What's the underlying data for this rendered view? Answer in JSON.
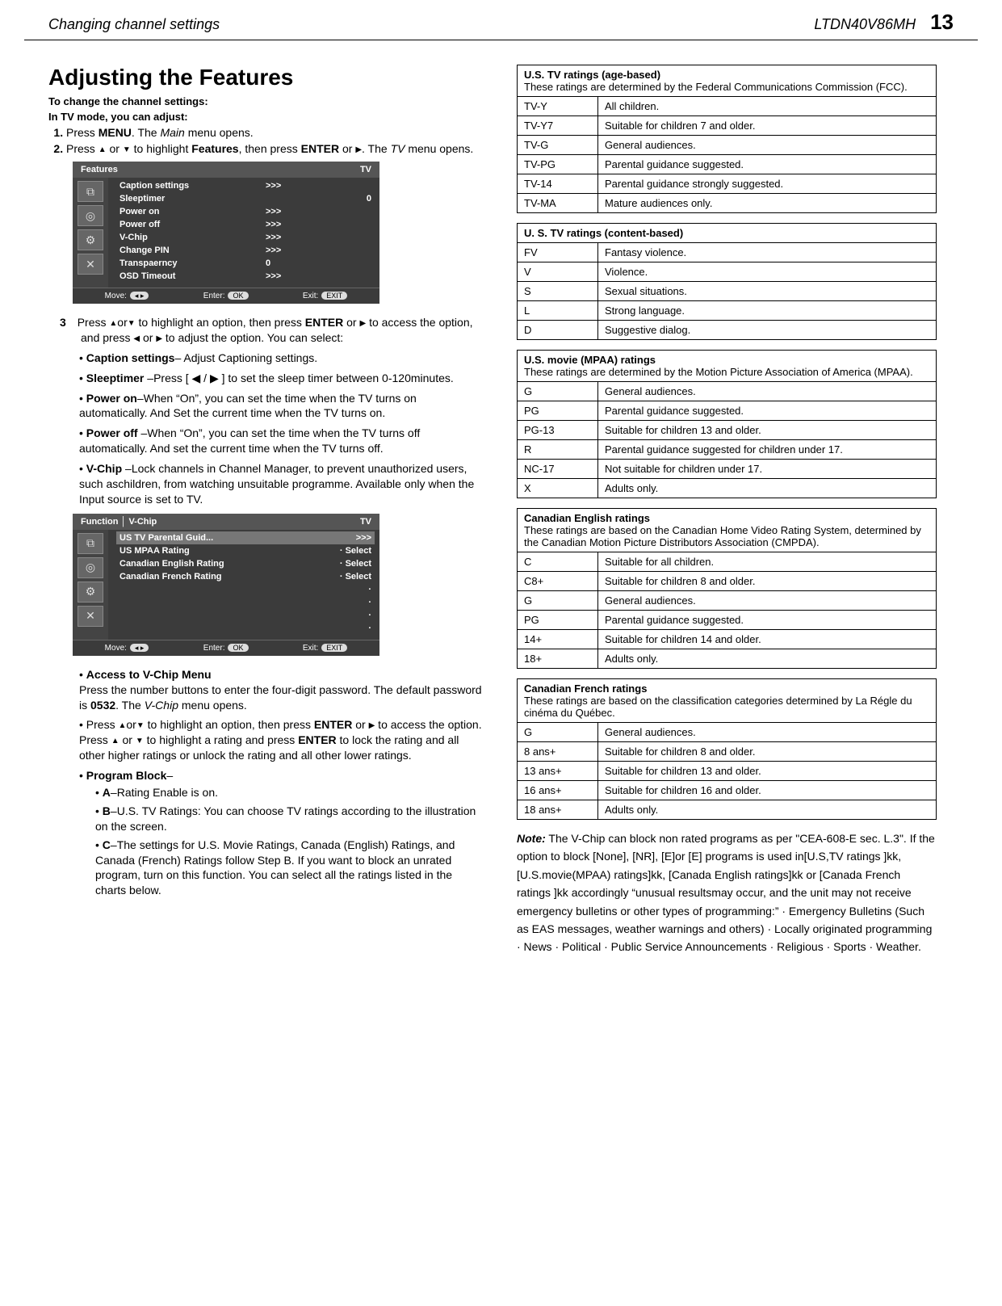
{
  "header": {
    "section": "Changing channel settings",
    "model": "LTDN40V86MH",
    "page": "13"
  },
  "left": {
    "title": "Adjusting the Features",
    "pre1": "To change the channel settings:",
    "pre2": "In TV mode, you can adjust:",
    "step1_a": "Press ",
    "step1_menu": "MENU",
    "step1_b": ". The ",
    "step1_ital": "Main",
    "step1_c": " menu opens.",
    "step2_a": "Press ",
    "step2_b": " or ",
    "step2_c": " to highlight ",
    "step2_feat": "Features",
    "step2_d": ", then press ",
    "step2_enter": "ENTER",
    "step2_e": " or ",
    "step2_f": ". The ",
    "step2_ital": "TV",
    "step2_g": " menu opens.",
    "osd1": {
      "title": "Features",
      "mode": "TV",
      "rows": [
        {
          "label": "Caption settings",
          "arrow": ">>>",
          "val": ""
        },
        {
          "label": "Sleeptimer",
          "arrow": "",
          "val": "0"
        },
        {
          "label": "Power on",
          "arrow": ">>>",
          "val": ""
        },
        {
          "label": "Power off",
          "arrow": ">>>",
          "val": ""
        },
        {
          "label": "V-Chip",
          "arrow": ">>>",
          "val": ""
        },
        {
          "label": "Change PIN",
          "arrow": ">>>",
          "val": ""
        },
        {
          "label": "Transpaerncy",
          "arrow": "0",
          "val": ""
        },
        {
          "label": "OSD Timeout",
          "arrow": ">>>",
          "val": ""
        }
      ],
      "ft_move": "Move:",
      "ft_enter": "Enter:",
      "ft_exit": "Exit:",
      "b_ok": "OK",
      "b_exit": "EXIT"
    },
    "step3": {
      "a": "Press ",
      "b": "or",
      "c": " to highlight an option, then press ",
      "enter": "ENTER",
      "d": " or ",
      "e": " to access the option, and press ",
      "f": " or ",
      "g": " to adjust  the option. You can select:"
    },
    "bullets": [
      {
        "b": "Caption settings",
        "t": "– Adjust Captioning settings."
      },
      {
        "b": "Sleeptimer",
        "t": " –Press [ ◀ / ▶ ] to set the sleep timer between 0-120minutes."
      },
      {
        "b": "Power on",
        "t": "–When “On”, you can set the time when the TV turns on automatically. And Set the current time when the TV turns on."
      },
      {
        "b": "Power off",
        "t": " –When “On”, you can set the time when the TV turns off automatically. And set the current time when the TV turns off."
      },
      {
        "b": "V-Chip",
        "t": " –Lock channels in Channel Manager, to prevent unauthorized  users, such aschildren, from watching unsuitable programme. Available only when the Input source is set to TV."
      }
    ],
    "osd2": {
      "func": "Function",
      "title": "V-Chip",
      "mode": "TV",
      "rows": [
        {
          "label": "US TV Parental Guid...",
          "val": ">>>",
          "sel": true
        },
        {
          "label": "US MPAA Rating",
          "val": "·  Select"
        },
        {
          "label": "Canadian English Rating",
          "val": "·  Select"
        },
        {
          "label": "Canadian French Rating",
          "val": "·  Select"
        },
        {
          "label": "",
          "val": "·"
        },
        {
          "label": "",
          "val": "·"
        },
        {
          "label": "",
          "val": "·"
        },
        {
          "label": "",
          "val": "·"
        }
      ],
      "ft_move": "Move:",
      "ft_enter": "Enter:",
      "ft_exit": "Exit:",
      "b_ok": "OK",
      "b_exit": "EXIT"
    },
    "after": {
      "acc_h": "Access to V-Chip Menu",
      "acc_t": "Press the number buttons to enter the four-digit password. The default password is ",
      "acc_pin": "0532",
      "acc_t2": ". The ",
      "acc_ital": "V-Chip",
      "acc_t3": " menu opens.",
      "press_a": "Press ",
      "press_b": "or",
      "press_c": " to highlight an option, then press ",
      "press_enter": "ENTER",
      "press_d": " or ",
      "press_e": " to access the option. Press ",
      "press_f": " or ",
      "press_g": " to highlight a rating and press  ",
      "press_enter2": "ENTER",
      "press_h": "   to lock the rating and all other higher ratings or unlock the rating and all other lower ratings.",
      "pb_h": "Program Block",
      "pb_a": "A",
      "pb_at": "–Rating Enable is on.",
      "pb_b": "B",
      "pb_bt": "–U.S. TV Ratings: You can choose TV ratings according to the illustration on the screen.",
      "pb_c": "C",
      "pb_ct": "–The settings for U.S. Movie Ratings, Canada (English) Ratings, and Canada (French) Ratings follow Step B. If you want to block an unrated program, turn on this function. You can select all the ratings listed in the charts below."
    }
  },
  "right": {
    "t1_h": "U.S. TV ratings (age-based)",
    "t1_d": "These ratings are determined by the Federal Communications Commission (FCC).",
    "t1": [
      [
        "TV-Y",
        "All children."
      ],
      [
        "TV-Y7",
        "Suitable for children 7 and older."
      ],
      [
        "TV-G",
        "General audiences."
      ],
      [
        "TV-PG",
        "Parental guidance suggested."
      ],
      [
        "TV-14",
        "Parental guidance strongly suggested."
      ],
      [
        "TV-MA",
        "Mature audiences only."
      ]
    ],
    "t2_h": "U. S. TV ratings (content-based)",
    "t2": [
      [
        "FV",
        "Fantasy violence."
      ],
      [
        "V",
        "Violence."
      ],
      [
        "S",
        "Sexual situations."
      ],
      [
        "L",
        "Strong language."
      ],
      [
        "D",
        "Suggestive dialog."
      ]
    ],
    "t3_h": "U.S. movie (MPAA) ratings",
    "t3_d": "These ratings are determined by the Motion Picture Association of America (MPAA).",
    "t3": [
      [
        "G",
        "General audiences."
      ],
      [
        "PG",
        "Parental guidance suggested."
      ],
      [
        "PG-13",
        "Suitable for children 13 and older."
      ],
      [
        "R",
        "Parental guidance suggested for children under 17."
      ],
      [
        "NC-17",
        "Not suitable for children under 17."
      ],
      [
        "X",
        "Adults only."
      ]
    ],
    "t4_h": "Canadian English ratings",
    "t4_d": "These ratings are based on the Canadian Home Video Rating System, determined by the Canadian Motion Picture Distributors Association (CMPDA).",
    "t4": [
      [
        "C",
        "Suitable for all children."
      ],
      [
        "C8+",
        "Suitable for children 8 and older."
      ],
      [
        "G",
        "General audiences."
      ],
      [
        "PG",
        "Parental guidance suggested."
      ],
      [
        "14+",
        "Suitable for children 14 and older."
      ],
      [
        "18+",
        "Adults only."
      ]
    ],
    "t5_h": "Canadian French ratings",
    "t5_d": "These ratings are based on the classification categories determined by La Régle du cinéma du Québec.",
    "t5": [
      [
        "G",
        "General audiences."
      ],
      [
        "8 ans+",
        "Suitable for children 8 and older."
      ],
      [
        "13 ans+",
        "Suitable for children 13 and older."
      ],
      [
        "16 ans+",
        "Suitable for children 16 and older."
      ],
      [
        "18 ans+",
        "Adults only."
      ]
    ],
    "note_h": "Note:",
    "note_t": "The V-Chip can block non rated programs as per \"CEA-608-E sec. L.3\". If the option to block [None], [NR], [E]or [E] programs is used in[U.S,TV ratings ]kk, [U.S.movie(MPAA) ratings]kk, [Canada English ratings]kk or [Canada French ratings ]kk accordingly “unusual resultsmay occur, and the unit may not receive emergency bulletins or other types of programming:” · Emergency Bulletins (Such as EAS messages, weather warnings and others) · Locally originated programming · News · Political · Public Service Announcements · Religious · Sports · Weather."
  }
}
